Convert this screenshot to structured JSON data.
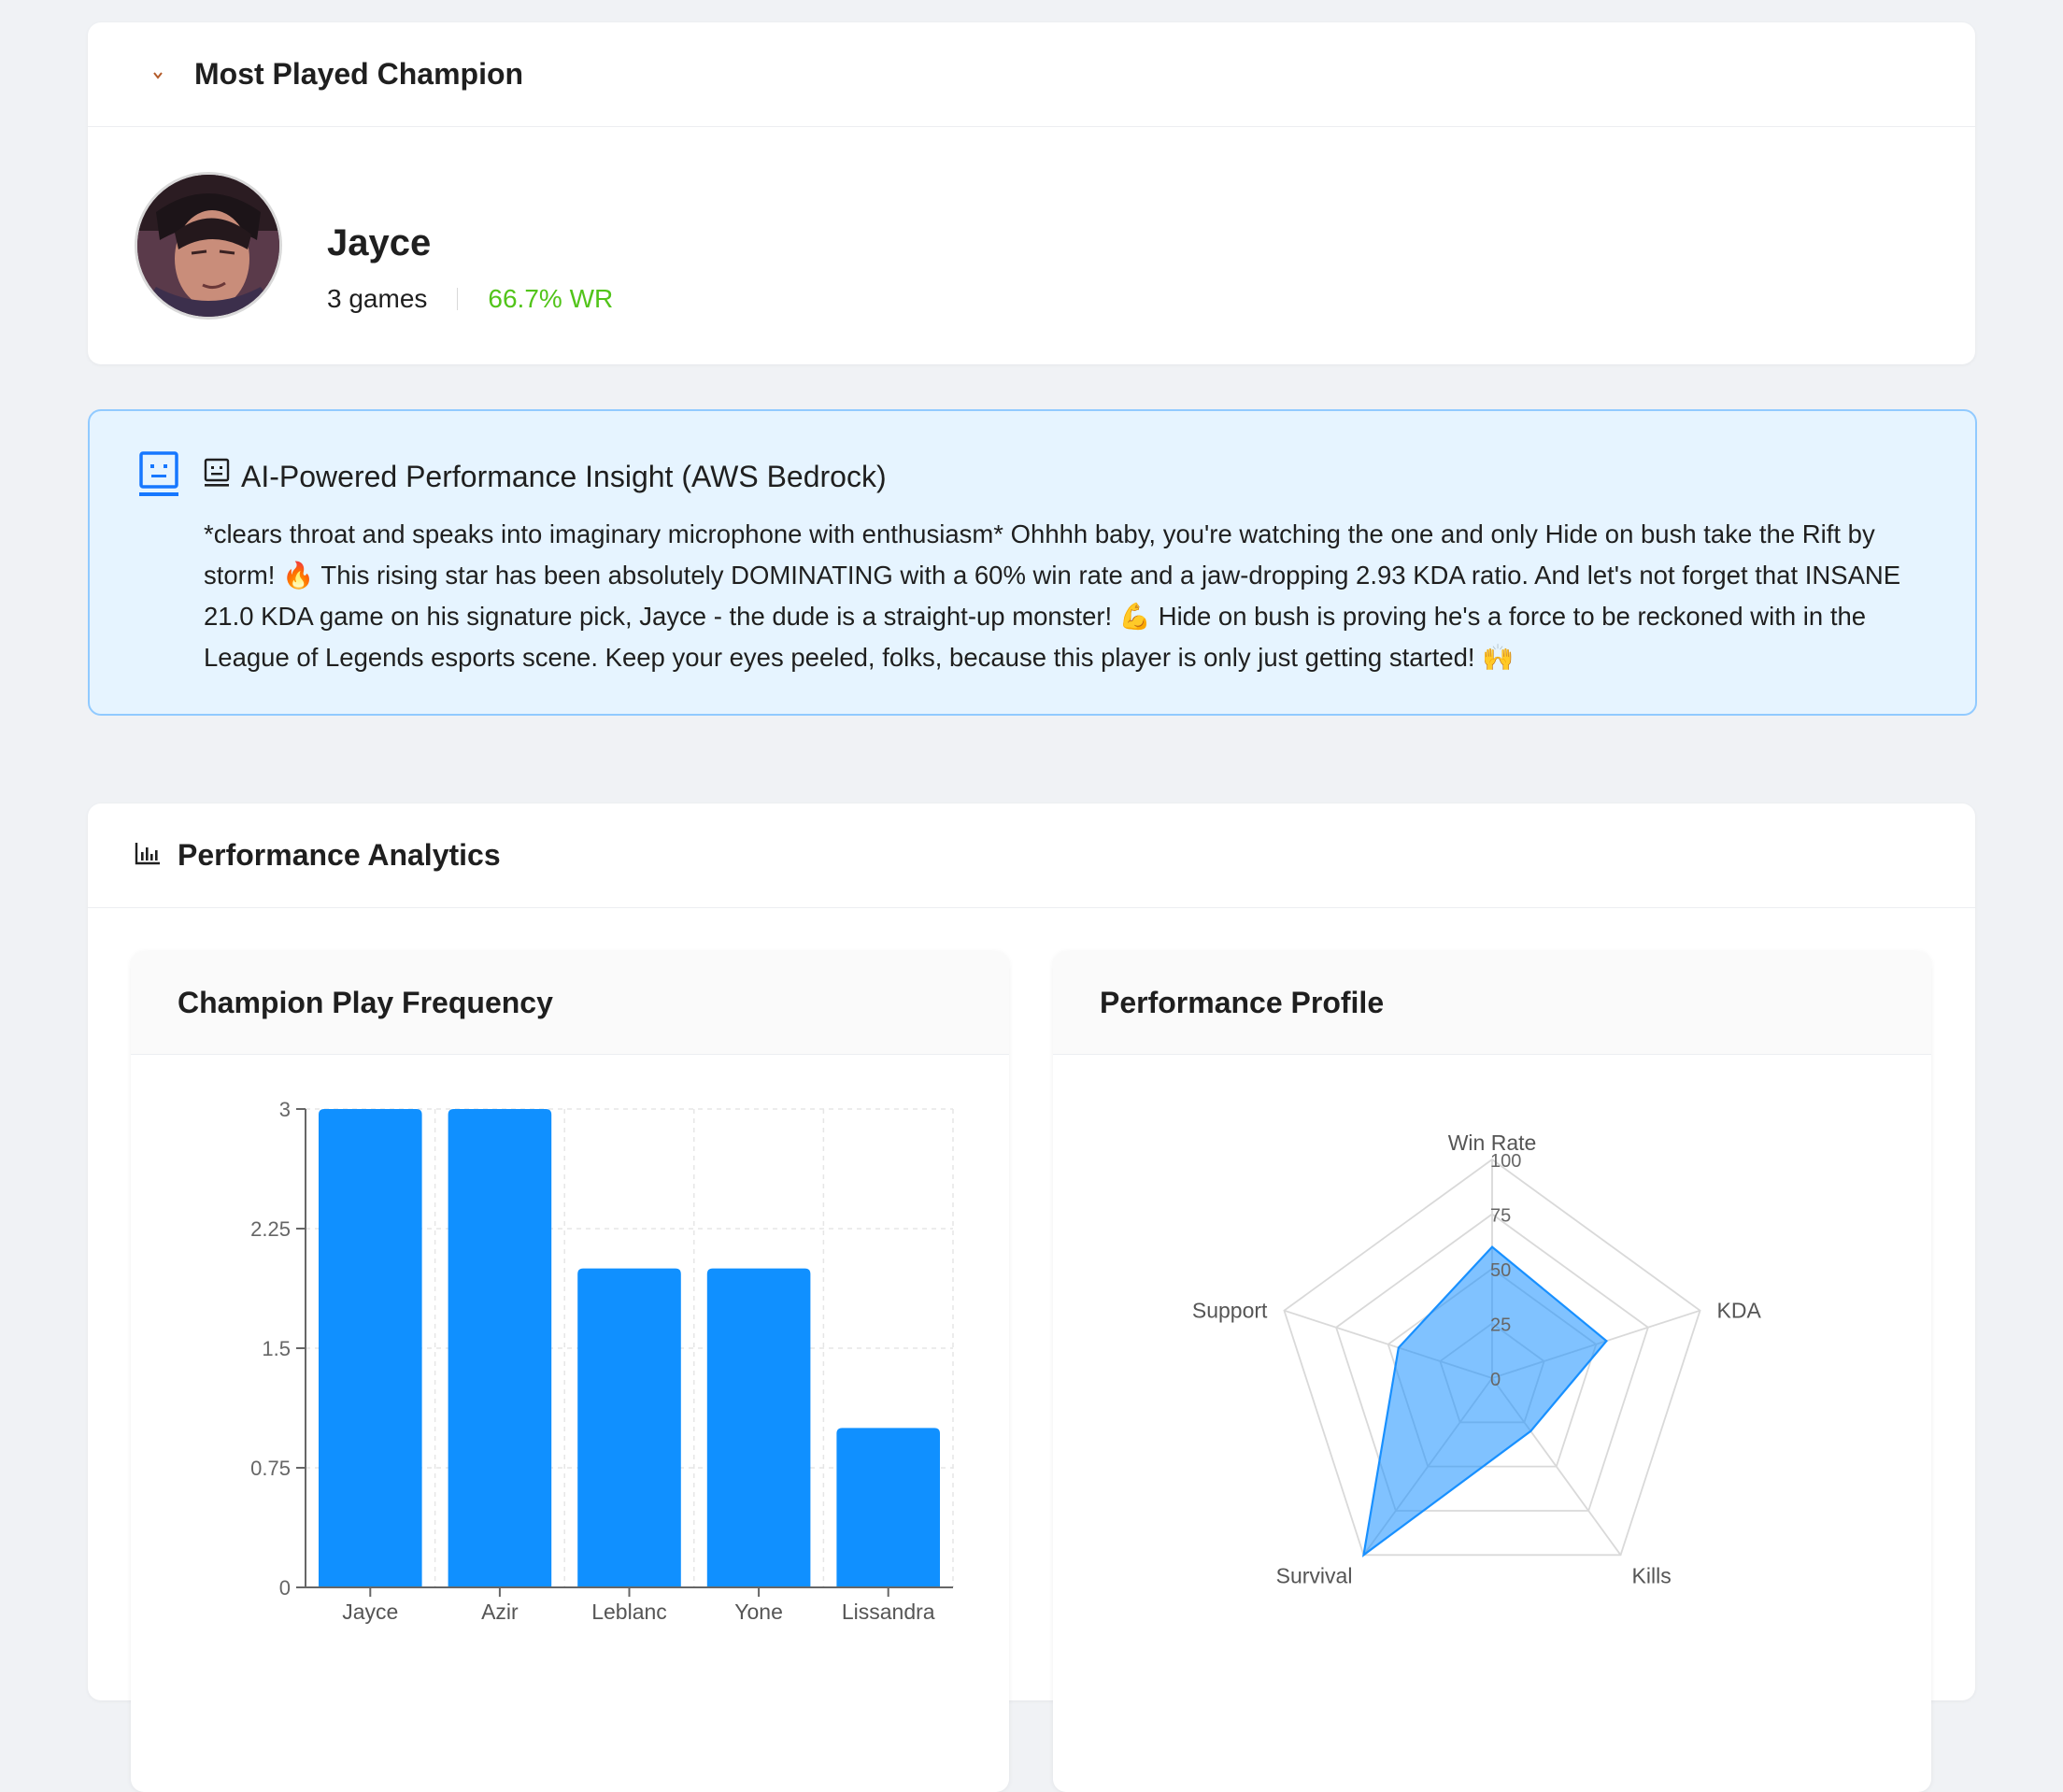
{
  "champion_card": {
    "title": "Most Played Champion",
    "name": "Jayce",
    "games": "3 games",
    "win_rate": "66.7% WR",
    "win_rate_color": "#52c41a"
  },
  "insight": {
    "title": "AI-Powered Performance Insight (AWS Bedrock)",
    "text": "*clears throat and speaks into imaginary microphone with enthusiasm* Ohhhh baby, you're watching the one and only Hide on bush take the Rift by storm! 🔥 This rising star has been absolutely DOMINATING with a 60% win rate and a jaw-dropping 2.93 KDA ratio. And let's not forget that INSANE 21.0 KDA game on his signature pick, Jayce - the dude is a straight-up monster! 💪 Hide on bush is proving he's a force to be reckoned with in the League of Legends esports scene. Keep your eyes peeled, folks, because this player is only just getting started! 🙌"
  },
  "analytics": {
    "title": "Performance Analytics"
  },
  "chart_data": [
    {
      "type": "bar",
      "title": "Champion Play Frequency",
      "categories": [
        "Jayce",
        "Azir",
        "Leblanc",
        "Yone",
        "Lissandra"
      ],
      "values": [
        3,
        3,
        2,
        2,
        1
      ],
      "ylim": [
        0,
        3
      ],
      "yticks": [
        "0",
        "0.75",
        "1.5",
        "2.25",
        "3"
      ],
      "grid": true,
      "color": "#1090ff"
    },
    {
      "type": "radar",
      "title": "Performance Profile",
      "axes": [
        "Win Rate",
        "KDA",
        "Kills",
        "Survival",
        "Support"
      ],
      "values": [
        60,
        55,
        30,
        100,
        45
      ],
      "range": [
        0,
        100
      ],
      "ticks": [
        "0",
        "25",
        "50",
        "75",
        "100"
      ],
      "fill_color": "#1890ff",
      "grid_color": "#d9d9d9"
    }
  ]
}
